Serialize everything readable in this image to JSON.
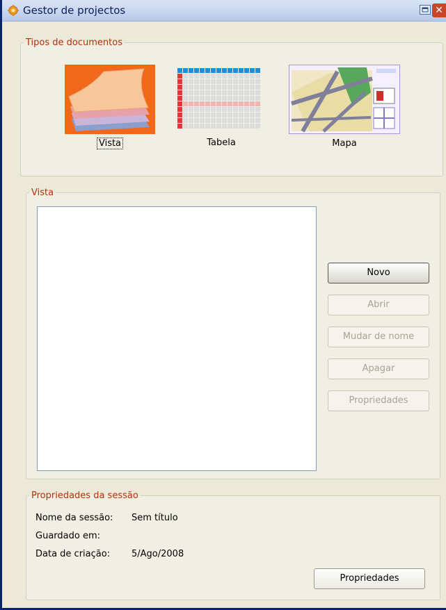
{
  "window": {
    "title": "Gestor de projectos",
    "icons": {
      "app": "gear-icon",
      "restore": "restore-icon",
      "close": "close-icon"
    },
    "close_glyph": "✕"
  },
  "document_types": {
    "legend": "Tipos de documentos",
    "items": [
      {
        "label": "Vista",
        "icon": "layers-icon",
        "selected": true
      },
      {
        "label": "Tabela",
        "icon": "table-icon",
        "selected": false
      },
      {
        "label": "Mapa",
        "icon": "map-icon",
        "selected": false
      }
    ]
  },
  "documents": {
    "legend": "Vista",
    "items": [],
    "buttons": {
      "new": "Novo",
      "open": "Abrir",
      "rename": "Mudar de nome",
      "delete": "Apagar",
      "properties": "Propriedades"
    }
  },
  "session": {
    "legend": "Propriedades da sessão",
    "name_label": "Nome da sessão:",
    "name_value": "Sem título",
    "saved_label": "Guardado em:",
    "saved_value": "",
    "created_label": "Data de criação:",
    "created_value": "5/Ago/2008",
    "properties_button": "Propriedades"
  },
  "colors": {
    "legend_text": "#b5300a",
    "window_bg": "#ece9d8",
    "title_text": "#0a1f5c",
    "close_button": "#c8462a"
  }
}
